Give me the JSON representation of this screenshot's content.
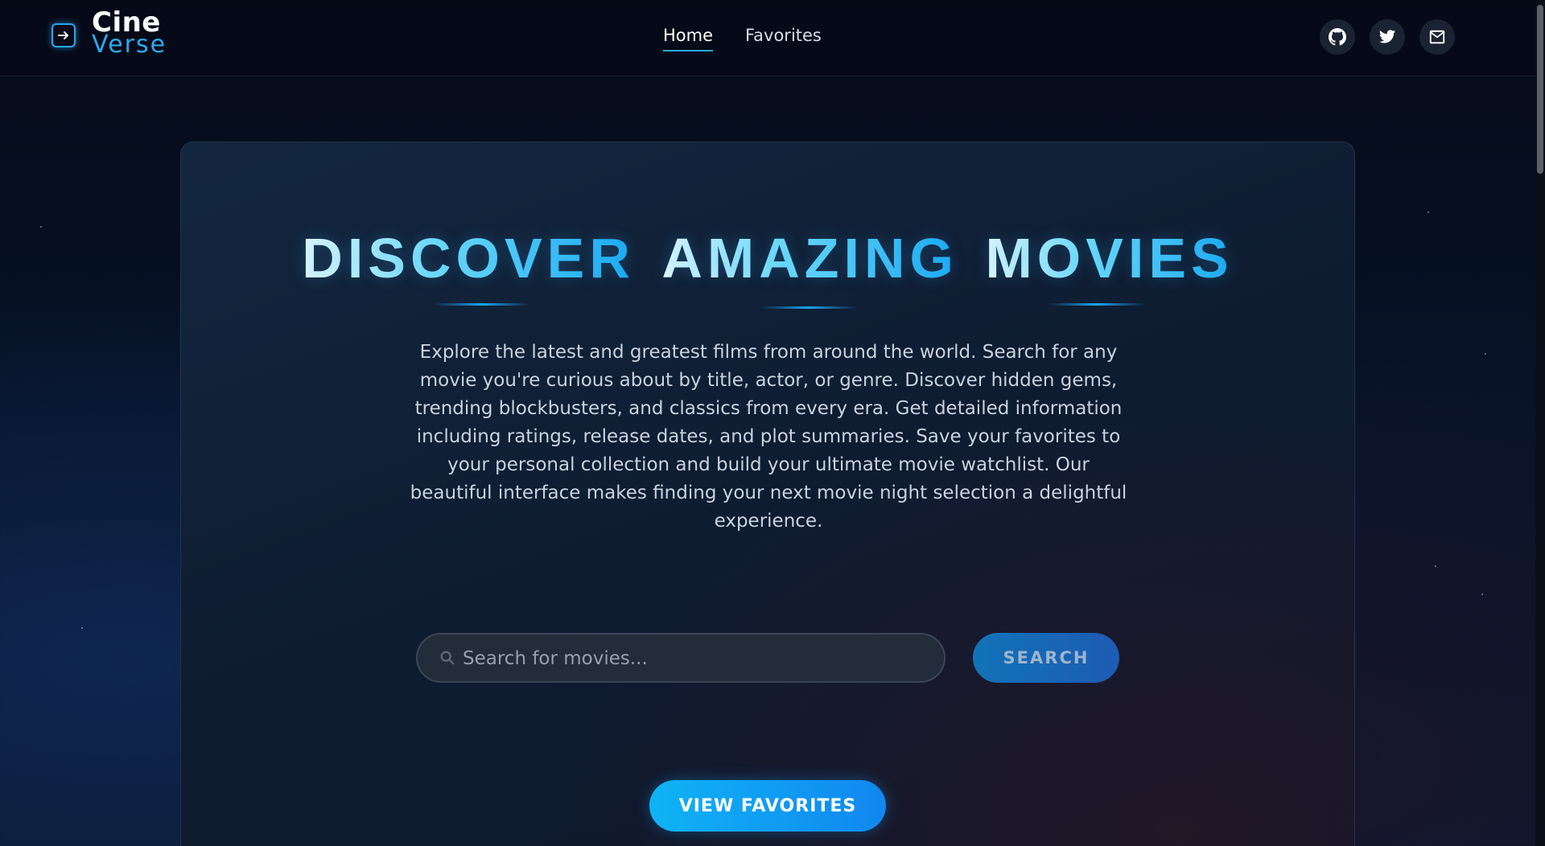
{
  "brand": {
    "name_top": "Cine",
    "name_bottom": "Verse",
    "icon": "film-enter-icon"
  },
  "nav": {
    "items": [
      {
        "label": "Home",
        "active": true
      },
      {
        "label": "Favorites",
        "active": false
      }
    ]
  },
  "socials": [
    {
      "icon": "github-icon"
    },
    {
      "icon": "twitter-icon"
    },
    {
      "icon": "mail-icon"
    }
  ],
  "hero": {
    "title_words": [
      "DISCOVER",
      "AMAZING",
      "MOVIES"
    ],
    "description": "Explore the latest and greatest films from around the world. Search for any movie you're curious about by title, actor, or genre. Discover hidden gems, trending blockbusters, and classics from every era. Get detailed information including ratings, release dates, and plot summaries. Save your favorites to your personal collection and build your ultimate movie watchlist. Our beautiful interface makes finding your next movie night selection a delightful experience."
  },
  "search": {
    "placeholder": "Search for movies...",
    "value": "",
    "button_label": "SEARCH"
  },
  "cta": {
    "favorites_label": "VIEW FAVORITES"
  },
  "colors": {
    "accent": "#2da9ef",
    "background": "#071328",
    "card": "#13273f"
  }
}
